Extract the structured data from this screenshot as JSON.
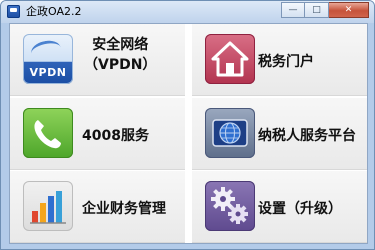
{
  "window": {
    "title": "企政OA2.2",
    "minimize_glyph": "—",
    "maximize_glyph": "□",
    "close_glyph": "✕"
  },
  "tiles": [
    {
      "icon": "vpdn-icon",
      "icon_text": "VPDN",
      "label_line1": "安全网络",
      "label_line2": "（VPDN）"
    },
    {
      "icon": "home-icon",
      "label": "税务门户"
    },
    {
      "icon": "phone-icon",
      "label": "4008服务"
    },
    {
      "icon": "globe-icon",
      "label": "纳税人服务平台"
    },
    {
      "icon": "bar-chart-icon",
      "label": "企业财务管理"
    },
    {
      "icon": "gears-icon",
      "label": "设置（升级）"
    }
  ],
  "colors": {
    "accent": "#2f63b8",
    "home": "#b2334f",
    "phone": "#4da62a",
    "gear": "#5f4a8f"
  }
}
